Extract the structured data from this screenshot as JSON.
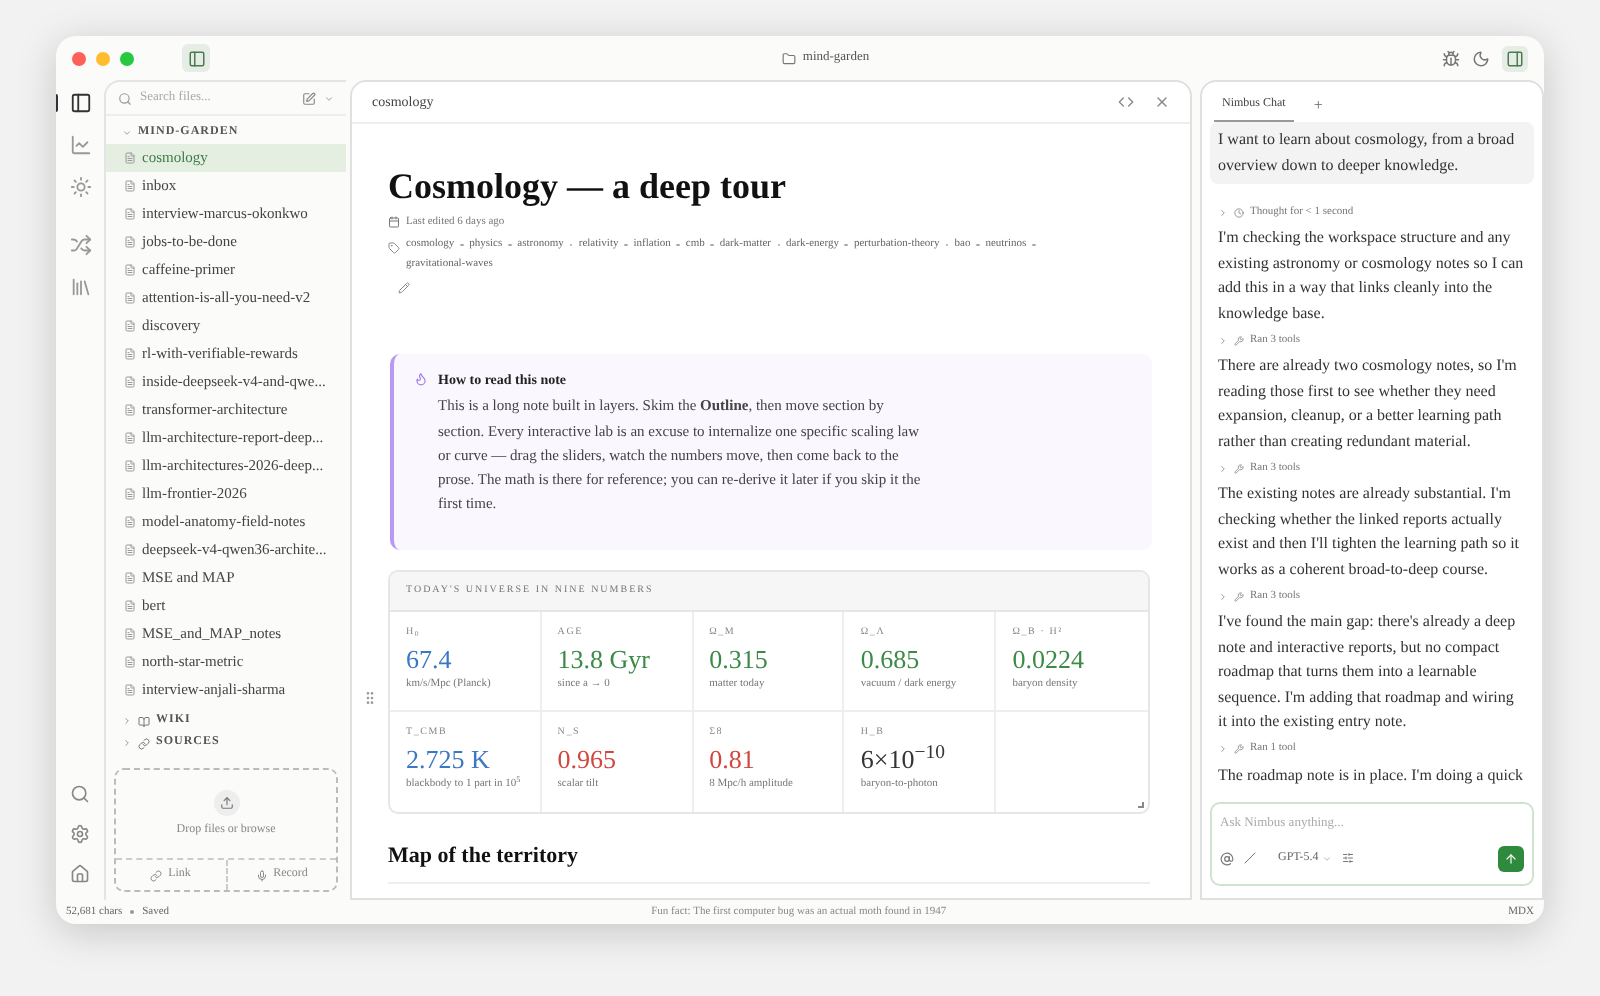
{
  "window": {
    "title": "mind-garden"
  },
  "rail": {
    "top": [
      {
        "selected": true
      },
      {
        "selected": false
      },
      {
        "selected": false
      },
      {
        "selected": false
      },
      {
        "selected": false
      }
    ]
  },
  "sidebar": {
    "search_placeholder": "Search files...",
    "sections": [
      {
        "label": "MIND-GARDEN",
        "expanded": true,
        "items": [
          {
            "label": "cosmology",
            "selected": true
          },
          {
            "label": "inbox",
            "selected": false
          },
          {
            "label": "interview-marcus-okonkwo",
            "selected": false
          },
          {
            "label": "jobs-to-be-done",
            "selected": false
          },
          {
            "label": "caffeine-primer",
            "selected": false
          },
          {
            "label": "attention-is-all-you-need-v2",
            "selected": false
          },
          {
            "label": "discovery",
            "selected": false
          },
          {
            "label": "rl-with-verifiable-rewards",
            "selected": false
          },
          {
            "label": "inside-deepseek-v4-and-qwe...",
            "selected": false
          },
          {
            "label": "transformer-architecture",
            "selected": false
          },
          {
            "label": "llm-architecture-report-deep...",
            "selected": false
          },
          {
            "label": "llm-architectures-2026-deep...",
            "selected": false
          },
          {
            "label": "llm-frontier-2026",
            "selected": false
          },
          {
            "label": "model-anatomy-field-notes",
            "selected": false
          },
          {
            "label": "deepseek-v4-qwen36-archite...",
            "selected": false
          },
          {
            "label": "MSE and MAP",
            "selected": false
          },
          {
            "label": "bert",
            "selected": false
          },
          {
            "label": "MSE_and_MAP_notes",
            "selected": false
          },
          {
            "label": "north-star-metric",
            "selected": false
          },
          {
            "label": "interview-anjali-sharma",
            "selected": false
          }
        ]
      },
      {
        "label": "WIKI",
        "expanded": false
      },
      {
        "label": "SOURCES",
        "expanded": false
      }
    ],
    "dropzone": {
      "label": "Drop files or browse",
      "buttons": [
        {
          "label": "Link"
        },
        {
          "label": "Record"
        }
      ]
    }
  },
  "editor": {
    "tab": "cosmology",
    "title": "Cosmology — a deep tour",
    "edited": "Last edited 6 days ago",
    "tags": [
      "cosmology",
      "physics",
      "astronomy",
      "relativity",
      "inflation",
      "cmb",
      "dark-matter",
      "dark-energy",
      "perturbation-theory",
      "bao",
      "neutrinos",
      "gravitational-waves"
    ],
    "callout": {
      "title": "How to read this note",
      "body": "This is a long note built in layers. Skim the **Outline**, then move section by section. Every interactive lab is an excuse to internalize one specific scaling law or curve — drag the sliders, watch the numbers move, then come back to the prose. The math is there for reference; you can re-derive it later if you skip it the first time."
    },
    "numbers": {
      "title": "TODAY'S UNIVERSE IN NINE NUMBERS",
      "cells": [
        {
          "label": "H$_{0}$",
          "value": "67.4",
          "caption": "km/s/Mpc (Planck)",
          "color": "#3b78c4"
        },
        {
          "label": "AGE",
          "value": "13.8 Gyr",
          "caption": "since a → 0",
          "color": "#3c8a47"
        },
        {
          "label": "Ω_M",
          "value": "0.315",
          "caption": "matter today",
          "color": "#3c8a47"
        },
        {
          "label": "Ω_Λ",
          "value": "0.685",
          "caption": "vacuum / dark energy",
          "color": "#3c8a47"
        },
        {
          "label": "Ω_B · H²",
          "value": "0.0224",
          "caption": "baryon density",
          "color": "#3c8a47"
        },
        {
          "label": "T_CMB",
          "value": "2.725 K",
          "caption": "blackbody to 1 part in 10$^{5}$",
          "color": "#3b78c4"
        },
        {
          "label": "N_S",
          "value": "0.965",
          "caption": "scalar tilt",
          "color": "#d0473e"
        },
        {
          "label": "Σ8",
          "value": "0.81",
          "caption": "8 Mpc/h amplitude",
          "color": "#d0473e"
        },
        {
          "label": "H_B",
          "value": "6×10$^{−10}$",
          "caption": "baryon-to-photon",
          "color": "#333333"
        }
      ]
    },
    "heading": "Map of the territory"
  },
  "chat": {
    "tabs": [
      {
        "label": "Nimbus Chat",
        "selected": true
      }
    ],
    "add": "+",
    "messages": [
      {
        "kind": "user",
        "text": "I want to learn about cosmology, from a broad overview down to deeper knowledge."
      },
      {
        "kind": "thought",
        "text": "Thought for < 1 second"
      },
      {
        "kind": "text",
        "text": "I'm checking the workspace structure and any existing astronomy or cosmology notes so I can add this in a way that links cleanly into the knowledge base."
      },
      {
        "kind": "tool",
        "text": "Ran 3 tools"
      },
      {
        "kind": "text",
        "text": "There are already two cosmology notes, so I'm reading those first to see whether they need expansion, cleanup, or a better learning path rather than creating redundant material."
      },
      {
        "kind": "tool",
        "text": "Ran 3 tools"
      },
      {
        "kind": "text",
        "text": "The existing notes are already substantial. I'm checking whether the linked reports actually exist and then I'll tighten the learning path so it works as a coherent broad-to-deep course."
      },
      {
        "kind": "tool",
        "text": "Ran 3 tools"
      },
      {
        "kind": "text",
        "text": "I've found the main gap: there's already a deep note and interactive reports, but no compact roadmap that turns them into a learnable sequence. I'm adding that roadmap and wiring it into the existing entry note."
      },
      {
        "kind": "tool",
        "text": "Ran 1 tool"
      },
      {
        "kind": "text",
        "text": "The roadmap note is in place. I'm doing a quick"
      }
    ],
    "input_placeholder": "Ask Nimbus anything...",
    "model": "GPT-5.4"
  },
  "status_bar": {
    "chars": "52,681 chars",
    "saved": "Saved",
    "fact": "Fun fact: The first computer bug was an actual moth found in 1947",
    "mode": "MDX"
  }
}
